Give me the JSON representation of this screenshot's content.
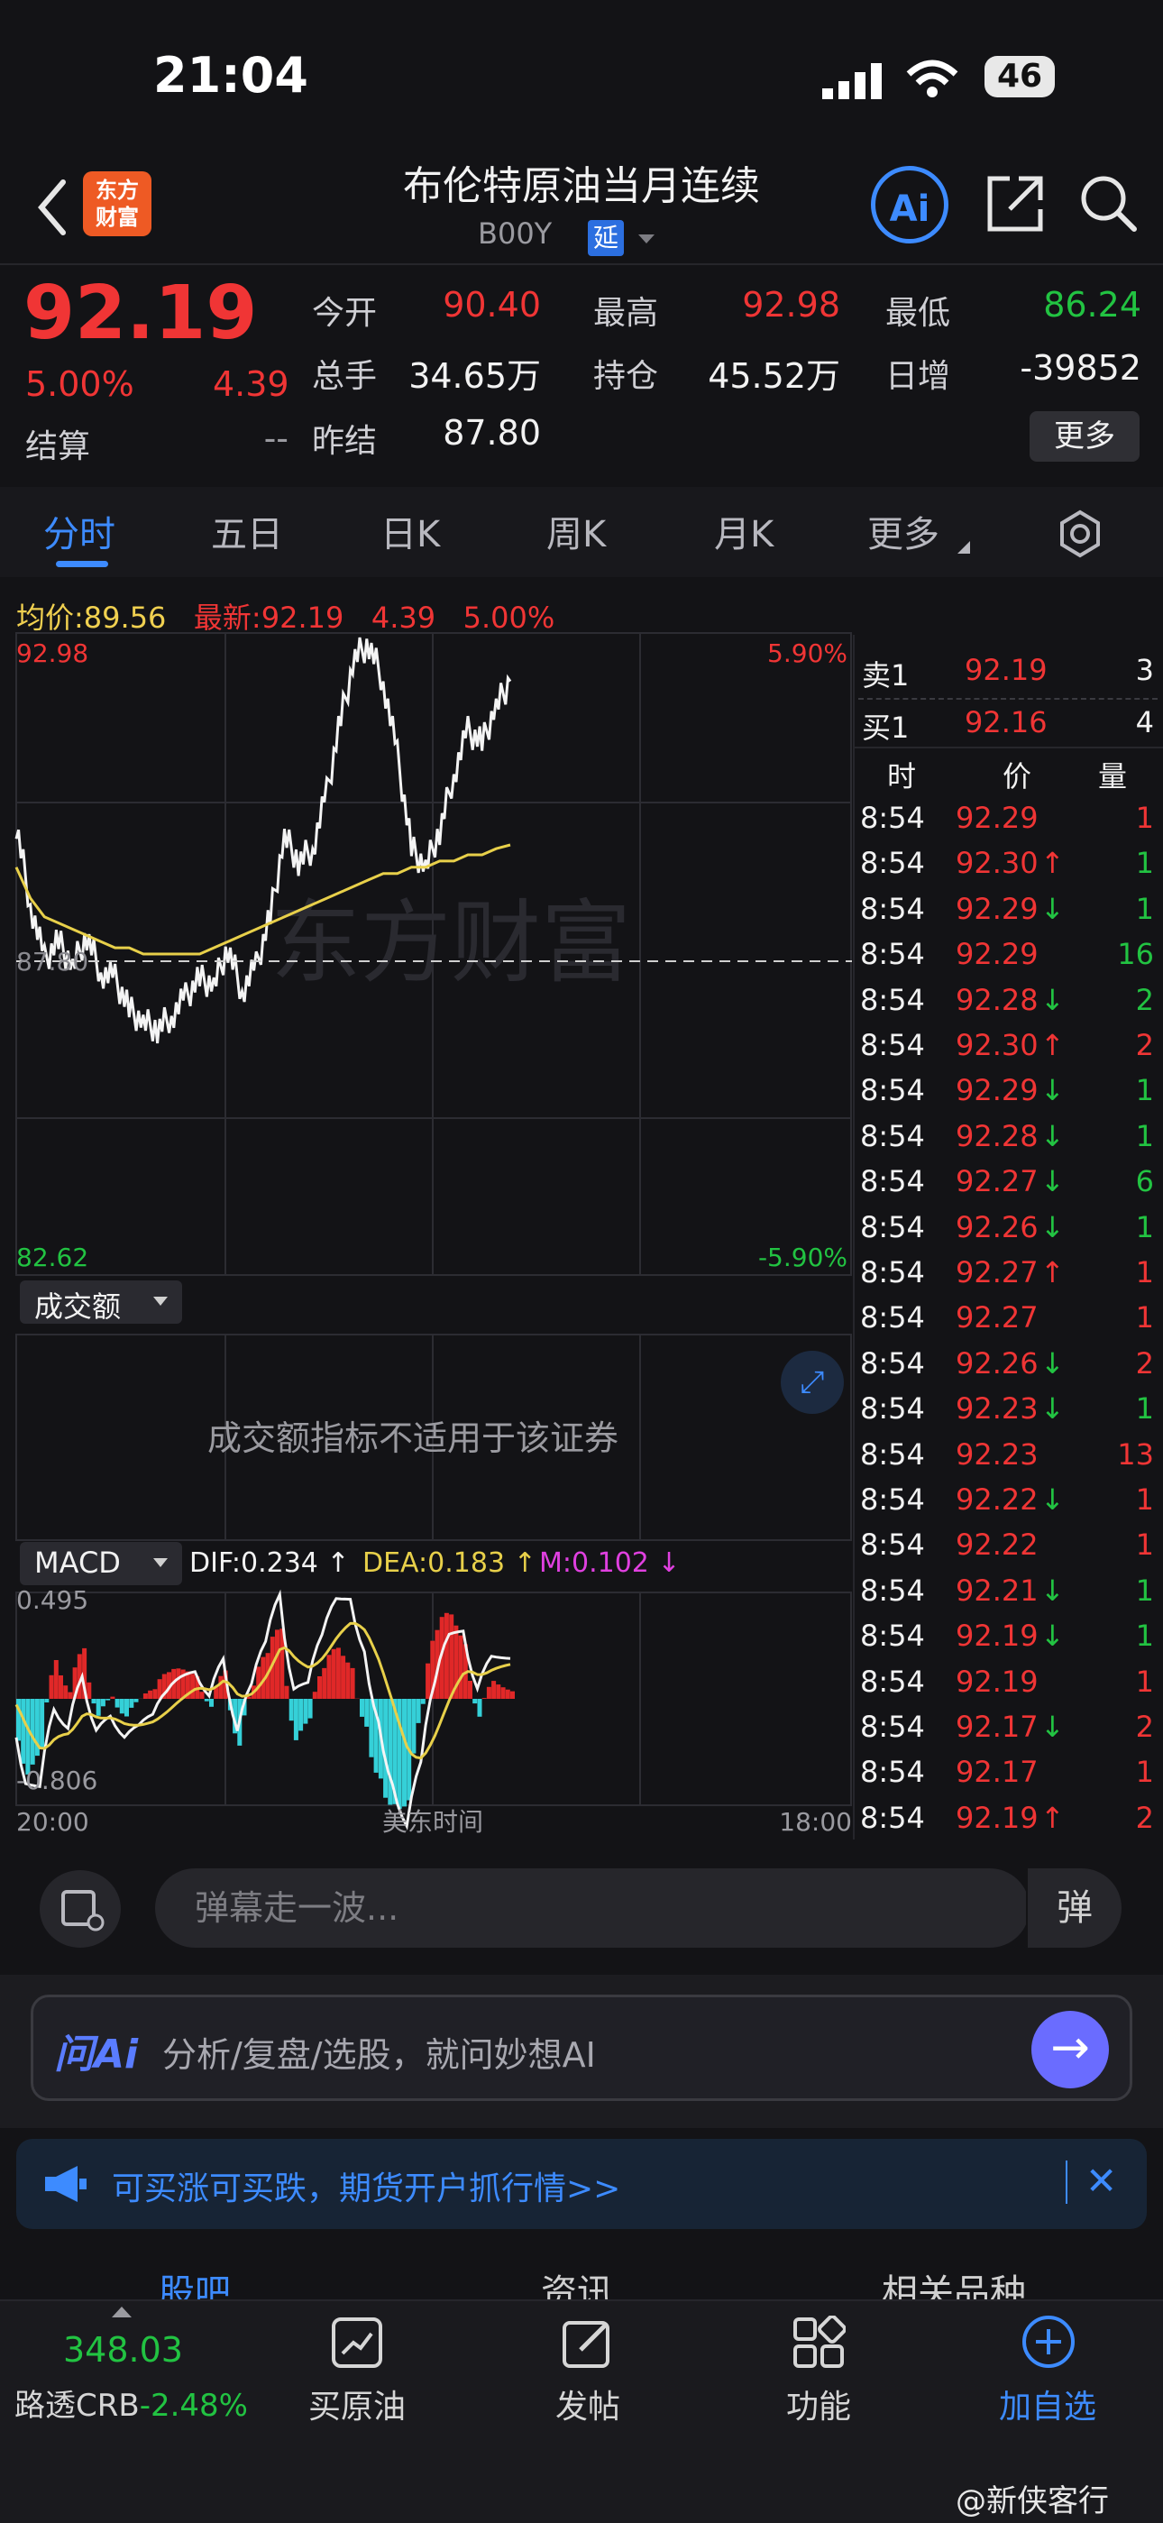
{
  "status": {
    "time": "21:04",
    "battery": "46"
  },
  "header": {
    "logo_line1": "东方",
    "logo_line2": "财富",
    "title": "布伦特原油当月连续",
    "code": "B00Y",
    "ext_badge": "延",
    "ai_label": "Ai"
  },
  "quote": {
    "price": "92.19",
    "pct": "5.00%",
    "change": "4.39",
    "settle_label": "结算",
    "settle_value": "--",
    "fields": [
      {
        "label": "今开",
        "value": "90.40",
        "color": "#f03535"
      },
      {
        "label": "最高",
        "value": "92.98",
        "color": "#f03535"
      },
      {
        "label": "最低",
        "value": "86.24",
        "color": "#22c342"
      },
      {
        "label": "总手",
        "value": "34.65万",
        "color": "#f2f2f2"
      },
      {
        "label": "持仓",
        "value": "45.52万",
        "color": "#f2f2f2"
      },
      {
        "label": "日增",
        "value": "-39852",
        "color": "#f2f2f2"
      },
      {
        "label": "昨结",
        "value": "87.80",
        "color": "#f2f2f2"
      }
    ],
    "more_label": "更多"
  },
  "tabs": [
    "分时",
    "五日",
    "日K",
    "周K",
    "月K",
    "更多"
  ],
  "legend": {
    "avg_label": "均价:",
    "avg_value": "89.56",
    "last_label": "最新:",
    "last_value": "92.19",
    "last_change": "4.39",
    "last_pct": "5.00%"
  },
  "chart_data": {
    "type": "line",
    "title": "",
    "x_range_labels": [
      "20:00",
      "美东时间",
      "18:00"
    ],
    "ylim": [
      82.62,
      92.98
    ],
    "y_labels": {
      "top": "92.98",
      "bottom": "82.62",
      "right_top": "5.90%",
      "right_bottom": "-5.90%",
      "mid": "87.80"
    },
    "series": [
      {
        "values": [
          89.9,
          88.6,
          87.7,
          88.0,
          87.6,
          88.1,
          87.5,
          87.4,
          86.9,
          86.7,
          86.6,
          86.8,
          87.1,
          87.4,
          87.3,
          87.9,
          87.2,
          87.6,
          88.4,
          89.7,
          89.3,
          89.5,
          90.4,
          91.6,
          92.6,
          92.8,
          92.2,
          91.0,
          89.5,
          89.2,
          89.8,
          90.7,
          91.4,
          91.2,
          91.8,
          92.2
        ]
      },
      {
        "values": [
          89.2,
          88.7,
          88.4,
          88.3,
          88.2,
          88.1,
          88.0,
          87.9,
          87.9,
          87.8,
          87.8,
          87.8,
          87.8,
          87.8,
          87.9,
          88.0,
          88.1,
          88.2,
          88.3,
          88.4,
          88.5,
          88.6,
          88.7,
          88.8,
          88.9,
          89.0,
          89.1,
          89.1,
          89.2,
          89.2,
          89.3,
          89.3,
          89.4,
          89.4,
          89.5,
          89.56
        ]
      }
    ],
    "watermark": "东方财富"
  },
  "volume": {
    "selector": "成交额",
    "message": "成交额指标不适用于该证券"
  },
  "macd": {
    "selector": "MACD",
    "dif": "DIF:0.234 ↑",
    "dea": "DEA:0.183 ↑",
    "m": "M:0.102 ↓",
    "top": "0.495",
    "bottom": "-0.806",
    "axis_left": "20:00",
    "axis_mid": "美东时间",
    "axis_right": "18:00"
  },
  "orderbook": {
    "ask": {
      "label": "卖1",
      "price": "92.19",
      "qty": "3"
    },
    "bid": {
      "label": "买1",
      "price": "92.16",
      "qty": "4"
    },
    "headers": [
      "时",
      "价",
      "量"
    ],
    "ticks": [
      {
        "t": "8:54",
        "p": "92.29",
        "a": "",
        "q": "1",
        "qc": "#f03535"
      },
      {
        "t": "8:54",
        "p": "92.30",
        "a": "↑",
        "q": "1",
        "qc": "#22c342"
      },
      {
        "t": "8:54",
        "p": "92.29",
        "a": "↓",
        "q": "1",
        "qc": "#22c342"
      },
      {
        "t": "8:54",
        "p": "92.29",
        "a": "",
        "q": "16",
        "qc": "#22c342"
      },
      {
        "t": "8:54",
        "p": "92.28",
        "a": "↓",
        "q": "2",
        "qc": "#22c342"
      },
      {
        "t": "8:54",
        "p": "92.30",
        "a": "↑",
        "q": "2",
        "qc": "#f03535"
      },
      {
        "t": "8:54",
        "p": "92.29",
        "a": "↓",
        "q": "1",
        "qc": "#22c342"
      },
      {
        "t": "8:54",
        "p": "92.28",
        "a": "↓",
        "q": "1",
        "qc": "#22c342"
      },
      {
        "t": "8:54",
        "p": "92.27",
        "a": "↓",
        "q": "6",
        "qc": "#22c342"
      },
      {
        "t": "8:54",
        "p": "92.26",
        "a": "↓",
        "q": "1",
        "qc": "#22c342"
      },
      {
        "t": "8:54",
        "p": "92.27",
        "a": "↑",
        "q": "1",
        "qc": "#f03535"
      },
      {
        "t": "8:54",
        "p": "92.27",
        "a": "",
        "q": "1",
        "qc": "#f03535"
      },
      {
        "t": "8:54",
        "p": "92.26",
        "a": "↓",
        "q": "2",
        "qc": "#f03535"
      },
      {
        "t": "8:54",
        "p": "92.23",
        "a": "↓",
        "q": "1",
        "qc": "#22c342"
      },
      {
        "t": "8:54",
        "p": "92.23",
        "a": "",
        "q": "13",
        "qc": "#f03535"
      },
      {
        "t": "8:54",
        "p": "92.22",
        "a": "↓",
        "q": "1",
        "qc": "#f03535"
      },
      {
        "t": "8:54",
        "p": "92.22",
        "a": "",
        "q": "1",
        "qc": "#f03535"
      },
      {
        "t": "8:54",
        "p": "92.21",
        "a": "↓",
        "q": "1",
        "qc": "#22c342"
      },
      {
        "t": "8:54",
        "p": "92.19",
        "a": "↓",
        "q": "1",
        "qc": "#22c342"
      },
      {
        "t": "8:54",
        "p": "92.19",
        "a": "",
        "q": "1",
        "qc": "#f03535"
      },
      {
        "t": "8:54",
        "p": "92.17",
        "a": "↓",
        "q": "2",
        "qc": "#f03535"
      },
      {
        "t": "8:54",
        "p": "92.17",
        "a": "",
        "q": "1",
        "qc": "#f03535"
      },
      {
        "t": "8:54",
        "p": "92.19",
        "a": "↑",
        "q": "2",
        "qc": "#f03535"
      }
    ]
  },
  "comment": {
    "placeholder": "弹幕走一波...",
    "danmu": "弹"
  },
  "ai_bar": {
    "logo": "问Ai",
    "text": "分析/复盘/选股，就问妙想AI",
    "go": "→"
  },
  "promo": {
    "text": "可买涨可买跌，期货开户抓行情>>",
    "close": "✕"
  },
  "section_tabs": [
    "股吧",
    "资讯",
    "相关品种"
  ],
  "bottom_nav": {
    "crb_value": "348.03",
    "crb_label": "路透CRB",
    "crb_pct": "-2.48%",
    "items": [
      "买原油",
      "发帖",
      "功能",
      "加自选"
    ]
  },
  "watermark": "@新侠客行",
  "colors": {
    "up": "#f03535",
    "down": "#22c342",
    "accent": "#3d8bff",
    "avg_line": "#e8d04a"
  }
}
